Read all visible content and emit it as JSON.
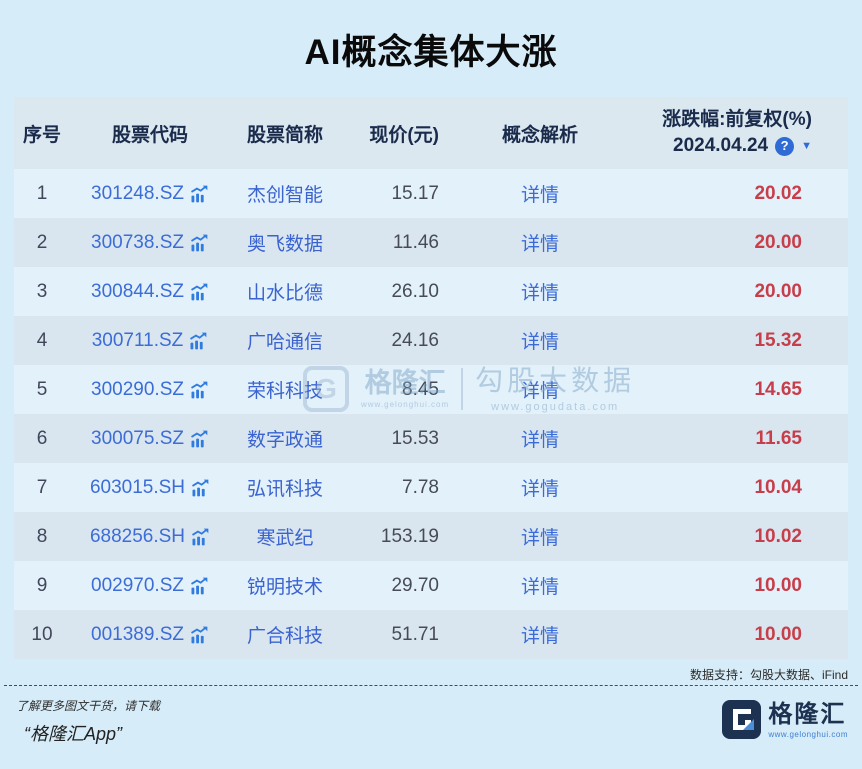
{
  "title": "AI概念集体大涨",
  "table": {
    "headers": {
      "index": "序号",
      "code": "股票代码",
      "name": "股票简称",
      "price": "现价(元)",
      "concept": "概念解析",
      "change_line1": "涨跌幅:前复权(%)",
      "change_date": "2024.04.24",
      "help_icon": "?",
      "sort_icon": "▼"
    },
    "detail_label": "详情",
    "rows": [
      {
        "index": "1",
        "code": "301248.SZ",
        "name": "杰创智能",
        "price": "15.17",
        "change": "20.02"
      },
      {
        "index": "2",
        "code": "300738.SZ",
        "name": "奥飞数据",
        "price": "11.46",
        "change": "20.00"
      },
      {
        "index": "3",
        "code": "300844.SZ",
        "name": "山水比德",
        "price": "26.10",
        "change": "20.00"
      },
      {
        "index": "4",
        "code": "300711.SZ",
        "name": "广哈通信",
        "price": "24.16",
        "change": "15.32"
      },
      {
        "index": "5",
        "code": "300290.SZ",
        "name": "荣科科技",
        "price": "8.45",
        "change": "14.65"
      },
      {
        "index": "6",
        "code": "300075.SZ",
        "name": "数字政通",
        "price": "15.53",
        "change": "11.65"
      },
      {
        "index": "7",
        "code": "603015.SH",
        "name": "弘讯科技",
        "price": "7.78",
        "change": "10.04"
      },
      {
        "index": "8",
        "code": "688256.SH",
        "name": "寒武纪",
        "price": "153.19",
        "change": "10.02"
      },
      {
        "index": "9",
        "code": "002970.SZ",
        "name": "锐明技术",
        "price": "29.70",
        "change": "10.00"
      },
      {
        "index": "10",
        "code": "001389.SZ",
        "name": "广合科技",
        "price": "51.71",
        "change": "10.00"
      }
    ]
  },
  "watermark": {
    "logo_letter": "G",
    "brand": "格隆汇",
    "brand_url": "www.gelonghui.com",
    "partner": "勾股大数据",
    "partner_url": "www.gogudata.com"
  },
  "footer": {
    "data_support": "数据支持：勾股大数据、iFind",
    "promo_line1": "了解更多图文干货，请下载",
    "promo_line2": "“格隆汇App”",
    "logo_text": "格隆汇",
    "logo_url": "www.gelonghui.com"
  },
  "colors": {
    "page_bg": "#d6ecf8",
    "header_bg": "#dce8f0",
    "row_odd_bg": "#e3f1fa",
    "row_even_bg": "#d9e6ef",
    "accent_blue": "#2e6bd4",
    "link_blue": "#3a6bd8",
    "change_red": "#c73e4a",
    "header_text": "#1a2b4c",
    "logo_navy": "#1d3150"
  }
}
